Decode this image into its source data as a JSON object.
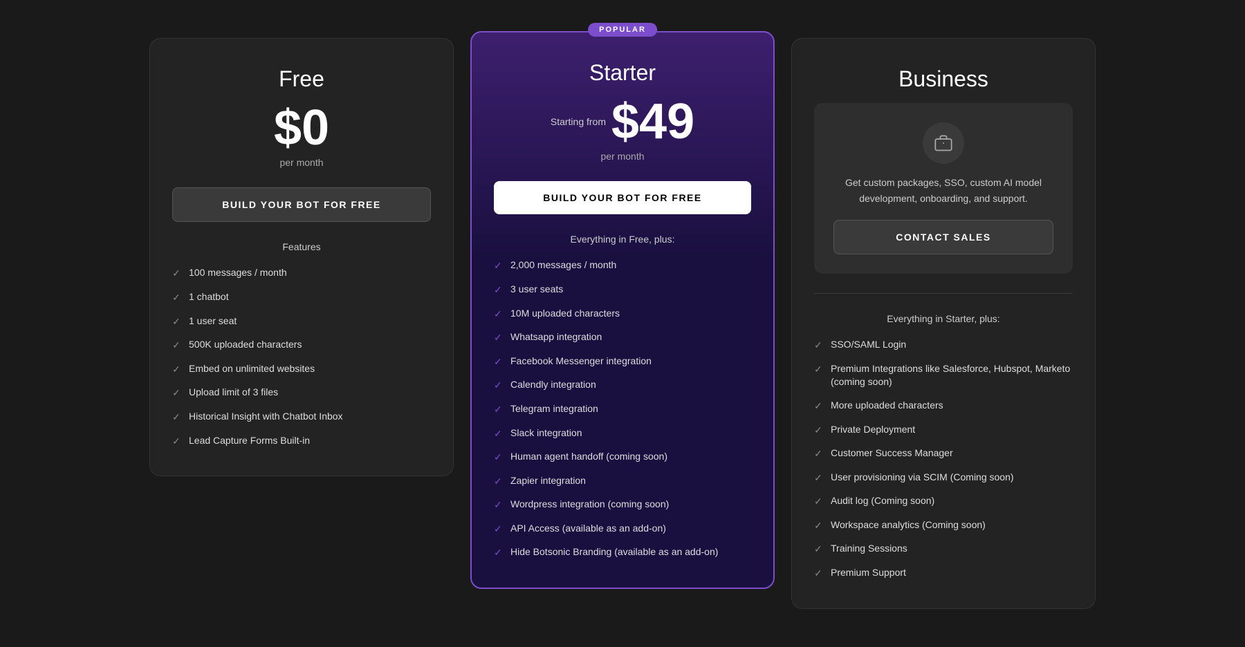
{
  "plans": {
    "free": {
      "title": "Free",
      "price": "$0",
      "period": "per month",
      "cta": "BUILD YOUR BOT FOR FREE",
      "features_label": "Features",
      "features": [
        "100 messages / month",
        "1 chatbot",
        "1 user seat",
        "500K uploaded characters",
        "Embed on unlimited websites",
        "Upload limit of 3 files",
        "Historical Insight with Chatbot Inbox",
        "Lead Capture Forms Built-in"
      ]
    },
    "starter": {
      "badge": "POPULAR",
      "title": "Starter",
      "price_prefix": "Starting from",
      "price": "$49",
      "period": "per month",
      "cta": "BUILD YOUR BOT FOR FREE",
      "features_label": "Everything in Free, plus:",
      "features": [
        "2,000 messages / month",
        "3 user seats",
        "10M uploaded characters",
        "Whatsapp integration",
        "Facebook Messenger integration",
        "Calendly integration",
        "Telegram integration",
        "Slack integration",
        "Human agent handoff (coming soon)",
        "Zapier integration",
        "Wordpress integration (coming soon)",
        "API Access (available as an add-on)",
        "Hide Botsonic Branding (available as an add-on)"
      ]
    },
    "business": {
      "title": "Business",
      "icon": "💼",
      "description": "Get custom packages, SSO, custom AI model development, onboarding, and support.",
      "cta": "CONTACT SALES",
      "features_label": "Everything in Starter, plus:",
      "features": [
        "SSO/SAML Login",
        "Premium Integrations like Salesforce, Hubspot, Marketo (coming soon)",
        "More uploaded characters",
        "Private Deployment",
        "Customer Success Manager",
        "User provisioning via SCIM (Coming soon)",
        "Audit log (Coming soon)",
        "Workspace analytics (Coming soon)",
        "Training Sessions",
        "Premium Support"
      ]
    }
  }
}
